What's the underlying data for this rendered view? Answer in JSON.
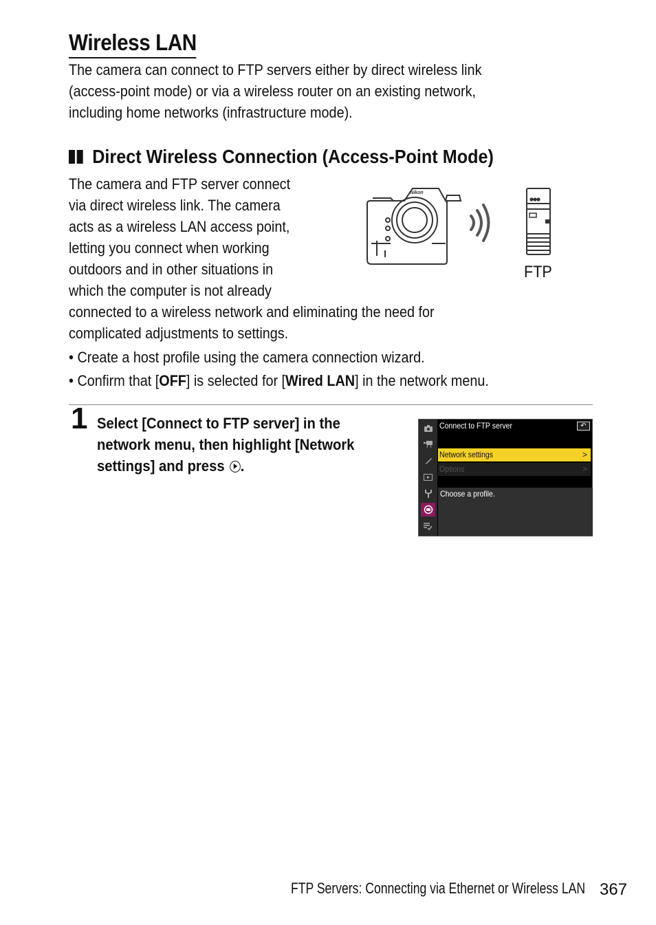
{
  "title": "Wireless LAN",
  "intro_lines": [
    "The camera can connect to FTP servers either by direct wireless link",
    "(access-point mode) or via a wireless router on an existing network,",
    "including home networks (infrastructure mode)."
  ],
  "section": {
    "heading": "Direct Wireless Connection (Access-Point Mode)",
    "body_lines": [
      "The camera and FTP server connect",
      "via direct wireless link. The camera",
      "acts as a wireless LAN access point,",
      "letting you connect when working",
      "outdoors and in other situations in",
      "which the computer is not already",
      "connected to a wireless network and eliminating the need for",
      "complicated adjustments to settings."
    ],
    "bullets": {
      "b1": "Create a host profile using the camera connection wizard.",
      "b2_pre": "Confirm that [",
      "b2_bold1": "OFF",
      "b2_mid": "] is selected for [",
      "b2_bold2": "Wired LAN",
      "b2_post": "] in the network menu."
    },
    "illustration": {
      "brand": "Nikon",
      "server_label": "FTP"
    }
  },
  "step": {
    "number": "1",
    "lines": [
      "Select [Connect to FTP server] in the",
      "network menu, then highlight [Network",
      "settings] and press"
    ],
    "end": "."
  },
  "camera_screen": {
    "title": "Connect to FTP server",
    "back_icon": "↶",
    "items": [
      {
        "label": "Network settings",
        "chevron": ">",
        "state": "highlighted"
      },
      {
        "label": "Options",
        "chevron": ">",
        "state": "disabled"
      }
    ],
    "help": "Choose a profile.",
    "sidebar_icons": [
      "photo-shooting-icon",
      "movie-recording-icon",
      "custom-settings-icon",
      "playback-icon",
      "setup-icon",
      "network-icon",
      "my-menu-icon"
    ],
    "colors": {
      "highlight": "#f5d128",
      "active_tab": "#8a1c5e"
    }
  },
  "footer": {
    "section_title": "FTP Servers: Connecting via Ethernet or Wireless LAN",
    "page_number": "367"
  }
}
